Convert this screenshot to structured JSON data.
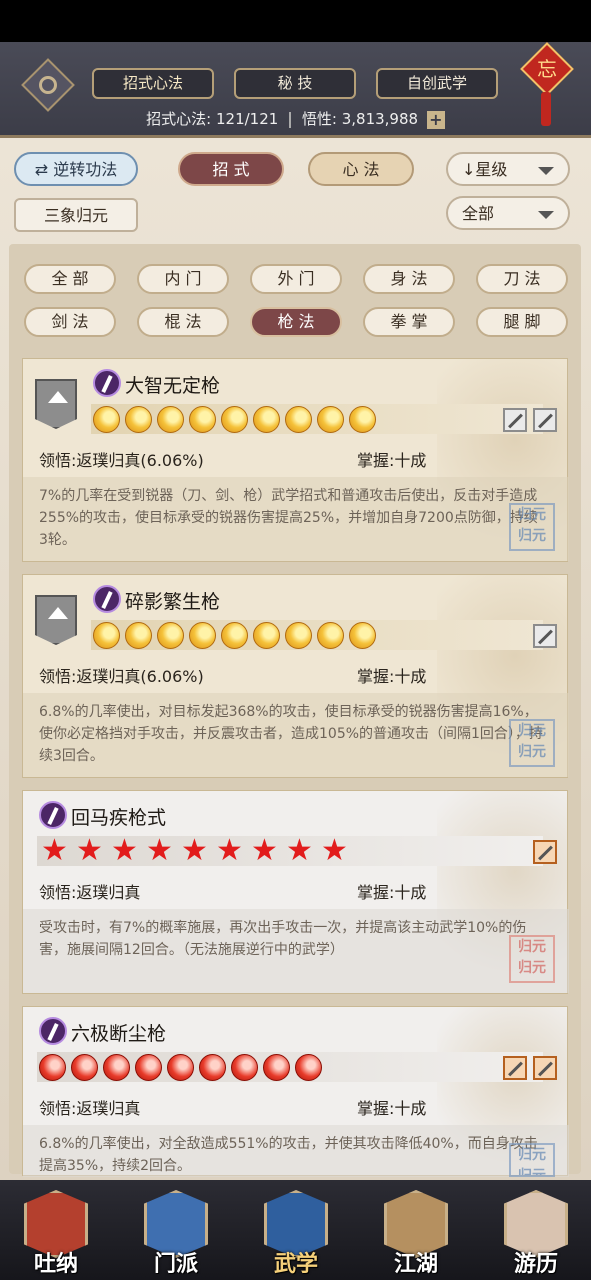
{
  "header": {
    "tabs": [
      {
        "label": "招式心法",
        "active": true
      },
      {
        "label": "秘 技",
        "active": false
      },
      {
        "label": "自创武学",
        "active": false
      }
    ],
    "knot_char": "忘",
    "stat_moves_label": "招式心法:",
    "stat_moves_value": "121/121",
    "stat_insight_label": "悟性:",
    "stat_insight_value": "3,813,988",
    "plus_label": "+"
  },
  "controls": {
    "reverse_label": "逆转功法",
    "tab_moves": "招 式",
    "tab_heart": "心 法",
    "sort_label": "↓星级",
    "sanxiang_label": "三象归元",
    "scope_label": "全部"
  },
  "filters": [
    "全 部",
    "内 门",
    "外 门",
    "身 法",
    "刀 法",
    "剑 法",
    "棍 法",
    "枪 法",
    "拳 掌",
    "腿 脚"
  ],
  "active_filter_index": 7,
  "cards": [
    {
      "name": "大智无定枪",
      "rank_type": "moon",
      "rank_count": 9,
      "comprehension_label": "领悟:",
      "comprehension_value": "返璞归真(6.06%)",
      "mastery_label": "掌握:",
      "mastery_value": "十成",
      "desc": "7%的几率在受到锐器（刀、剑、枪）武学招式和普通攻击后使出，反击对手造成255%的攻击，使目标承受的锐器伤害提高25%，并增加自身7200点防御，持续3轮。",
      "weapon_icons": [
        "compass-icon",
        "slash-icon"
      ],
      "seal": "归元\n归元"
    },
    {
      "name": "碎影繁生枪",
      "rank_type": "moon",
      "rank_count": 9,
      "comprehension_label": "领悟:",
      "comprehension_value": "返璞归真(6.06%)",
      "mastery_label": "掌握:",
      "mastery_value": "十成",
      "desc": "6.8%的几率使出，对目标发起368%的攻击，使目标承受的锐器伤害提高16%，使你必定格挡对手攻击，并反震攻击者，造成105%的普通攻击（间隔1回合），持续3回合。",
      "weapon_icons": [
        "runner-icon"
      ],
      "seal": "归元\n归元"
    },
    {
      "name": "回马疾枪式",
      "rank_type": "star",
      "rank_count": 9,
      "comprehension_label": "领悟:",
      "comprehension_value": "返璞归真",
      "mastery_label": "掌握:",
      "mastery_value": "十成",
      "desc": "受攻击时，有7%的概率施展，再次出手攻击一次，并提高该主动武学10%的伤害，施展间隔12回合。（无法施展逆行中的武学）",
      "weapon_icons": [
        "spear-icon"
      ],
      "seal": "归元\n归元"
    },
    {
      "name": "六极断尘枪",
      "rank_type": "redmoon",
      "rank_count": 9,
      "comprehension_label": "领悟:",
      "comprehension_value": "返璞归真",
      "mastery_label": "掌握:",
      "mastery_value": "十成",
      "desc": "6.8%的几率使出，对全敌造成551%的攻击，并使其攻击降低40%，而自身攻击提高35%，持续2回合。",
      "weapon_icons": [
        "blade-icon",
        "claw-icon"
      ],
      "seal": "归元\n归元"
    }
  ],
  "nav": [
    {
      "label": "吐纳",
      "active": false,
      "color": "#b4402e"
    },
    {
      "label": "门派",
      "active": false,
      "color": "#3f6fb0"
    },
    {
      "label": "武学",
      "active": true,
      "color": "#2f5f9e"
    },
    {
      "label": "江湖",
      "active": false,
      "color": "#b59060"
    },
    {
      "label": "游历",
      "active": false,
      "color": "#d9c3b0"
    }
  ]
}
